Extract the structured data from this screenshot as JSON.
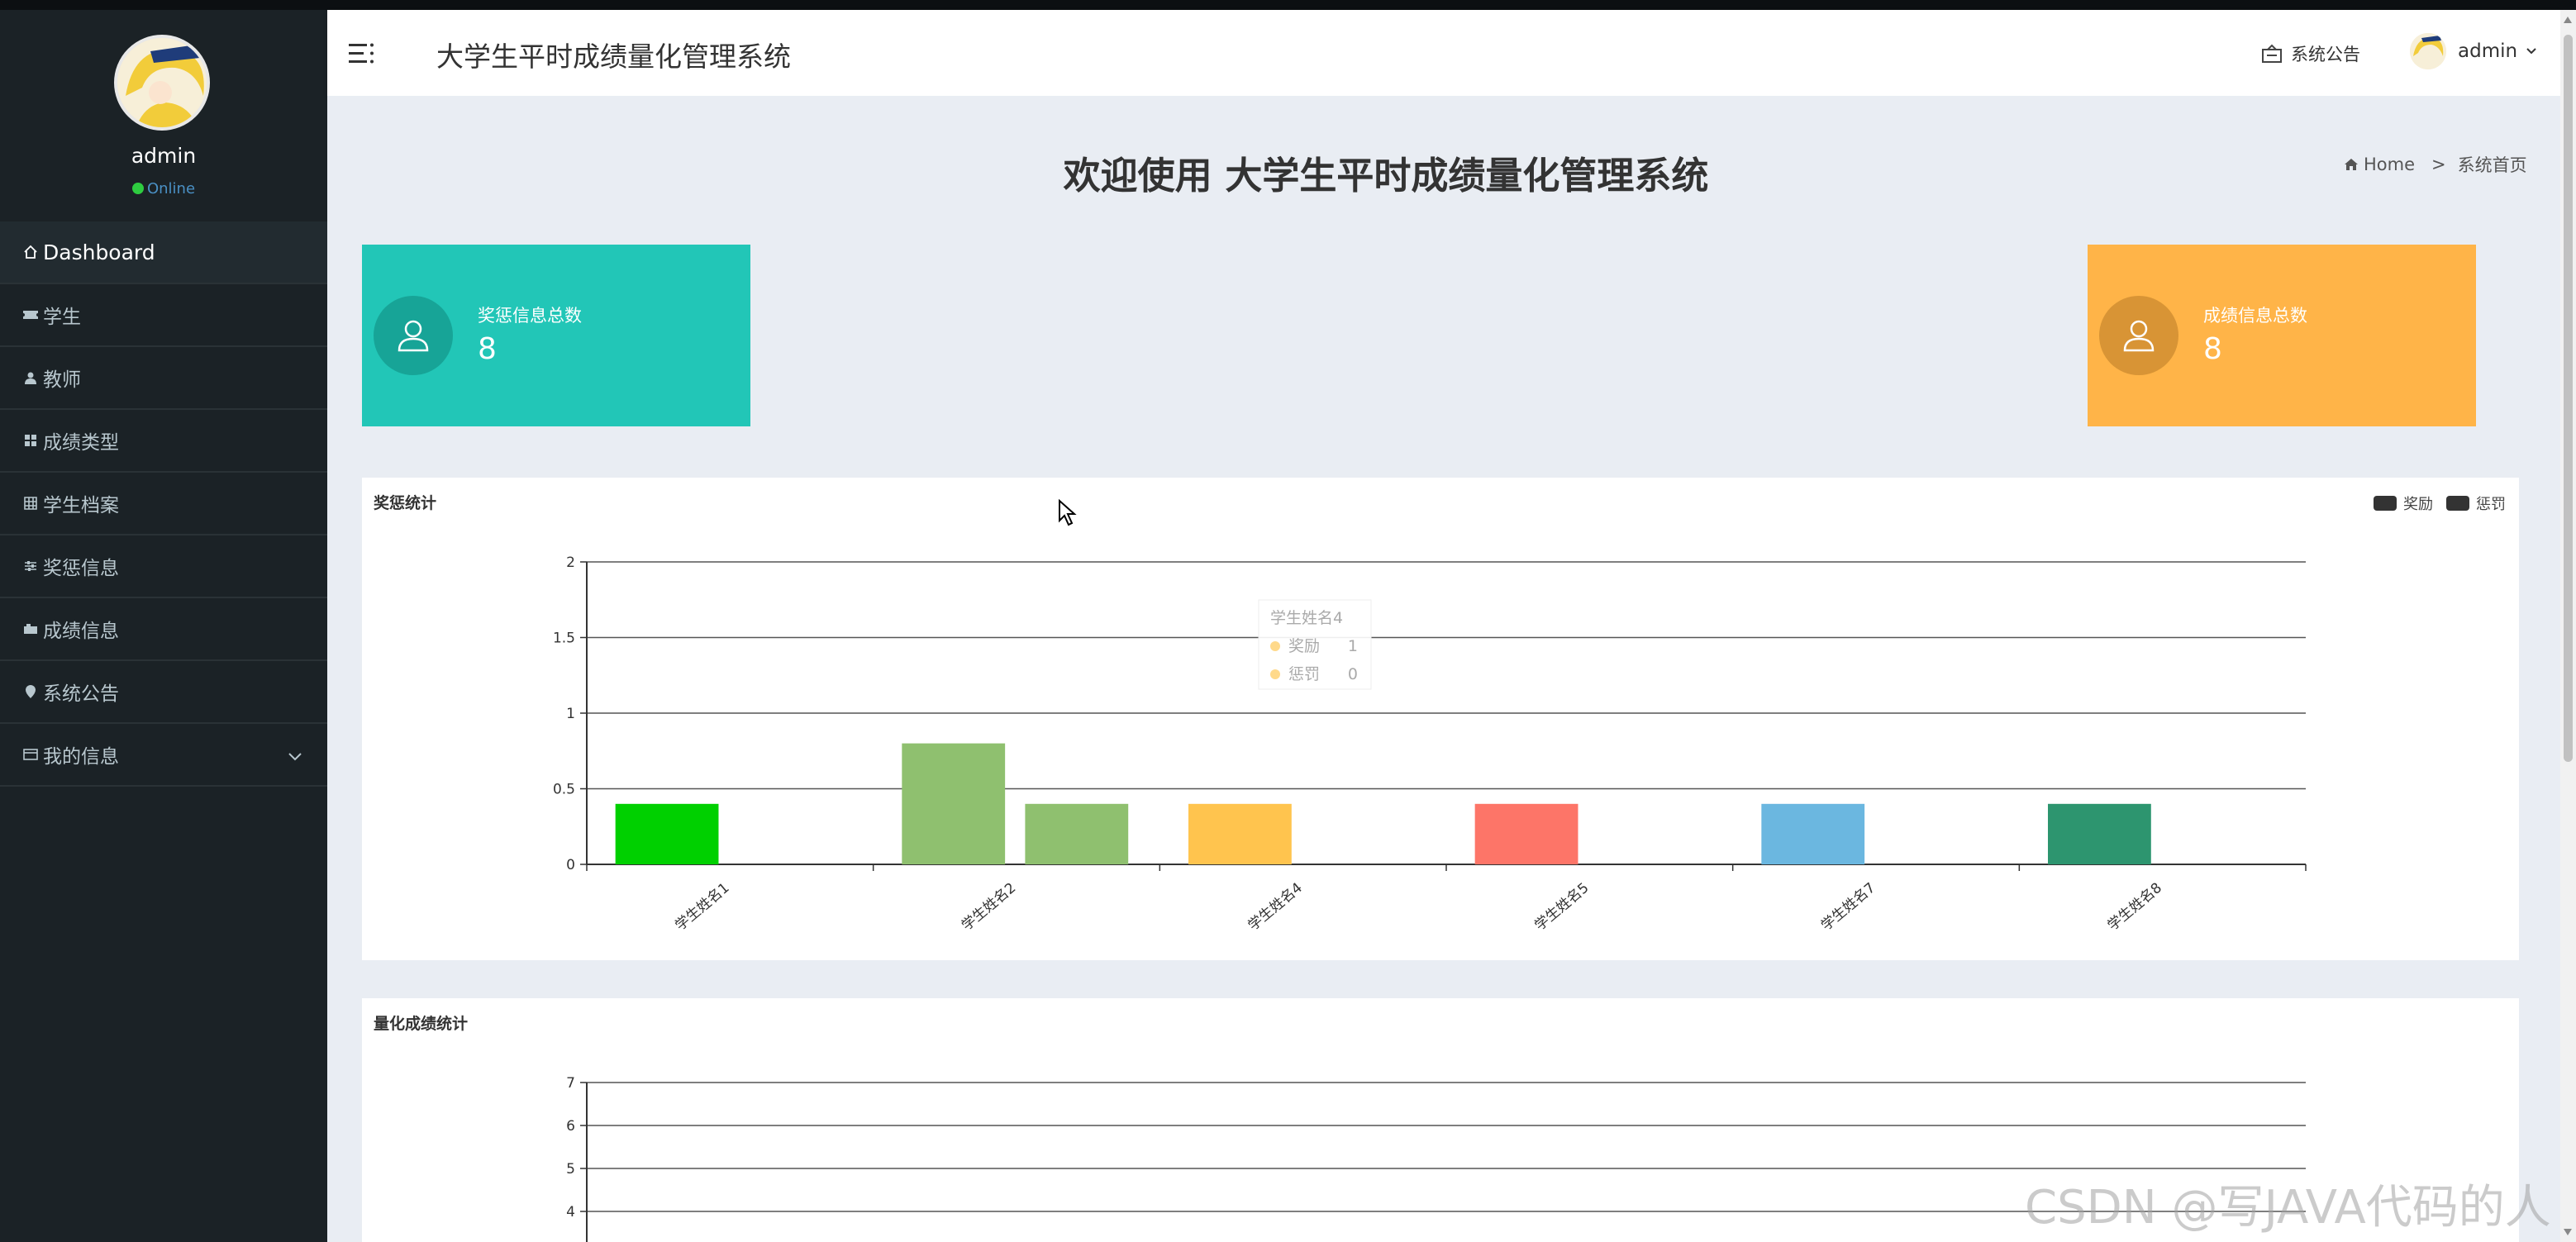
{
  "app": {
    "title": "大学生平时成绩量化管理系统"
  },
  "sidebar": {
    "username": "admin",
    "status": "Online",
    "items": [
      {
        "label": "Dashboard",
        "icon": "home-icon"
      },
      {
        "label": "学生",
        "icon": "ticket-icon"
      },
      {
        "label": "教师",
        "icon": "user-icon"
      },
      {
        "label": "成绩类型",
        "icon": "grid-icon"
      },
      {
        "label": "学生档案",
        "icon": "table-icon"
      },
      {
        "label": "奖惩信息",
        "icon": "sliders-icon"
      },
      {
        "label": "成绩信息",
        "icon": "camera-icon"
      },
      {
        "label": "系统公告",
        "icon": "pin-icon"
      },
      {
        "label": "我的信息",
        "icon": "card-icon"
      }
    ]
  },
  "header": {
    "notice": "系统公告",
    "user": "admin"
  },
  "main": {
    "welcome": "欢迎使用 大学生平时成绩量化管理系统",
    "breadcrumb": {
      "home": "Home",
      "sep": ">",
      "current": "系统首页"
    },
    "stats": [
      {
        "label": "奖惩信息总数",
        "value": "8",
        "color": "#22c6b7"
      },
      {
        "label": "成绩信息总数",
        "value": "8",
        "color": "#ffb448"
      }
    ]
  },
  "chart_data": [
    {
      "type": "bar",
      "title": "奖惩统计",
      "legend": [
        "奖励",
        "惩罚"
      ],
      "legend_position": "top-right",
      "categories": [
        "学生姓名1",
        "学生姓名2",
        "学生姓名4",
        "学生姓名5",
        "学生姓名7",
        "学生姓名8"
      ],
      "series": [
        {
          "name": "奖励",
          "values": [
            0.4,
            0.8,
            0.4,
            0.4,
            0.4,
            0.4
          ]
        },
        {
          "name": "惩罚",
          "values": [
            0,
            0.4,
            0,
            0,
            0,
            0
          ]
        }
      ],
      "bar_colors": [
        [
          "#00d000",
          null
        ],
        [
          "#8fc06f",
          "#8fc06f"
        ],
        [
          "#ffc44e",
          null
        ],
        [
          "#fd7568",
          null
        ],
        [
          "#6bb7e0",
          null
        ],
        [
          "#2d956f",
          null
        ]
      ],
      "ylim": [
        0,
        2
      ],
      "yticks": [
        0,
        0.5,
        1,
        1.5,
        2
      ],
      "tooltip": {
        "title": "学生姓名4",
        "rows": [
          {
            "name": "奖励",
            "value": "1"
          },
          {
            "name": "惩罚",
            "value": "0"
          }
        ]
      }
    },
    {
      "type": "bar",
      "title": "量化成绩统计",
      "yticks": [
        4,
        5,
        6,
        7
      ],
      "ylim_visible": [
        4,
        7
      ]
    }
  ],
  "watermark": "CSDN @写JAVA代码的人"
}
